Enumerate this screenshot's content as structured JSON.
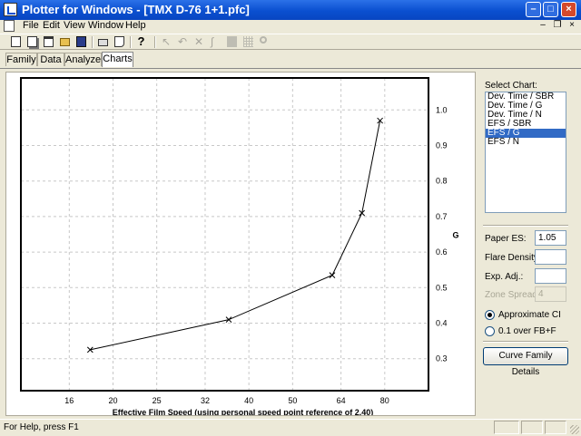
{
  "window": {
    "title": "Plotter for Windows - [TMX D-76 1+1.pfc]"
  },
  "menu": {
    "file": "File",
    "edit": "Edit",
    "view": "View",
    "window": "Window",
    "help": "Help"
  },
  "tabs": [
    {
      "label": "Family"
    },
    {
      "label": "Data"
    },
    {
      "label": "Analyze"
    },
    {
      "label": "Charts"
    }
  ],
  "sidebar": {
    "select_chart_label": "Select Chart:",
    "charts": [
      "Dev. Time / SBR",
      "Dev. Time / G",
      "Dev. Time / N",
      "EFS / SBR",
      "EFS / G",
      "EFS / N"
    ],
    "selected_chart": "EFS / G",
    "paper_es_label": "Paper ES:",
    "paper_es_value": "1.05",
    "flare_density_label": "Flare Density:",
    "flare_density_value": "",
    "exp_adj_label": "Exp. Adj.:",
    "exp_adj_value": "",
    "zone_spread_label": "Zone Spread:",
    "zone_spread_value": "4",
    "radio_approx_label": "Approximate CI",
    "radio_fbf_label": "0.1 over FB+F",
    "curve_button_label": "Curve Family Details"
  },
  "status": {
    "text": "For Help, press F1"
  },
  "icons": {
    "toolbar": [
      "new-icon",
      "copy-doc-icon",
      "paste-doc-icon",
      "open-folder-icon",
      "save-icon",
      "print-icon",
      "print-preview-icon",
      "help-icon",
      "pointer-icon",
      "undo-icon",
      "add-point-icon",
      "curve-icon",
      "fill-rect-icon",
      "grid-icon",
      "zoom-icon"
    ]
  },
  "chart_data": {
    "type": "line",
    "xlabel": "Effective Film Speed (using personal speed point reference of 2.40)",
    "ylabel": "G",
    "x_ticks": [
      16,
      20,
      25,
      32,
      40,
      50,
      64,
      80
    ],
    "y_ticks": [
      0.3,
      0.4,
      0.5,
      0.6,
      0.7,
      0.8,
      0.9,
      1.0
    ],
    "y_tick_labels": [
      "0.3",
      "0.4",
      "0.5",
      "0.6",
      "0.7",
      "0.8",
      "0.9",
      "1.0"
    ],
    "x_scale": "log",
    "ylim": [
      0.21,
      1.09
    ],
    "xlim": [
      12.5,
      100
    ],
    "grid": true,
    "series": [
      {
        "x": [
          17.8,
          36.1,
          61.2,
          71.2,
          78.1
        ],
        "y": [
          0.325,
          0.41,
          0.535,
          0.71,
          0.97
        ],
        "marker": "x"
      }
    ]
  }
}
